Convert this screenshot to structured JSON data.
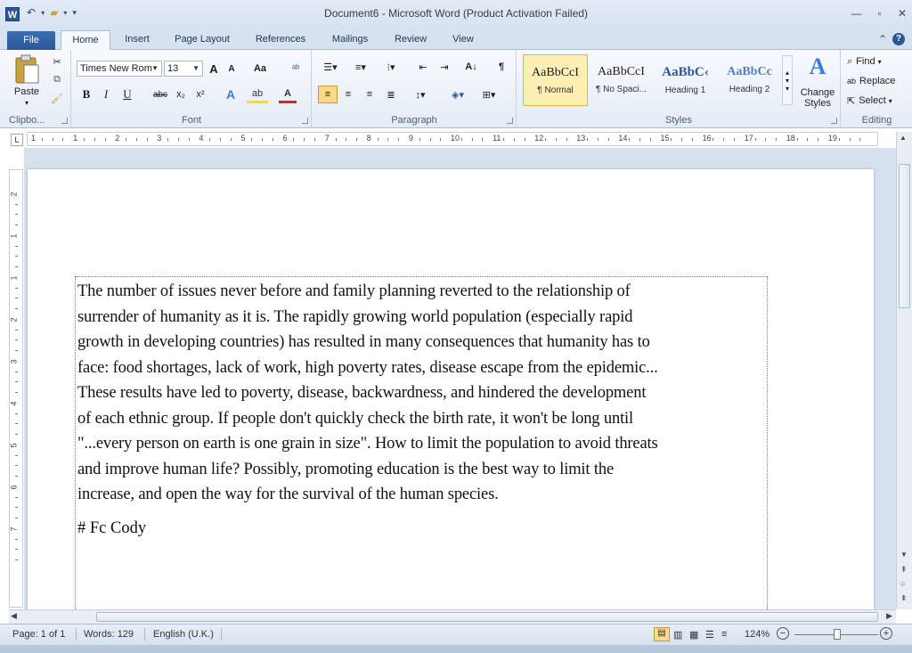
{
  "window": {
    "title": "Document6 - Microsoft Word (Product Activation Failed)",
    "app_icon": "W"
  },
  "tabs": [
    "File",
    "Home",
    "Insert",
    "Page Layout",
    "References",
    "Mailings",
    "Review",
    "View"
  ],
  "ribbon": {
    "clipboard": {
      "paste_label": "Paste",
      "group_label": "Clipbo..."
    },
    "font": {
      "name": "Times New Rom",
      "size": "13",
      "group_label": "Font",
      "grow": "A",
      "shrink": "A",
      "case": "Aa",
      "bold": "B",
      "italic": "I",
      "underline": "U",
      "strike": "abc",
      "sub": "x₂",
      "sup": "x²"
    },
    "paragraph": {
      "group_label": "Paragraph"
    },
    "styles": {
      "group_label": "Styles",
      "items": [
        {
          "sample": "AaBbCcI",
          "name": "¶ Normal"
        },
        {
          "sample": "AaBbCcI",
          "name": "¶ No Spaci..."
        },
        {
          "sample": "AaBbC‹",
          "name": "Heading 1"
        },
        {
          "sample": "AaBbCc",
          "name": "Heading 2"
        }
      ],
      "change_styles": "Change Styles"
    },
    "editing": {
      "group_label": "Editing",
      "find": "Find",
      "replace": "Replace",
      "select": "Select"
    }
  },
  "ruler": {
    "numbers": [
      "1",
      "1",
      "2",
      "3",
      "4",
      "5",
      "6",
      "7",
      "8",
      "9",
      "10",
      "11",
      "12",
      "13",
      "14",
      "15",
      "16",
      "17",
      "18",
      "19"
    ]
  },
  "vruler": {
    "numbers": [
      "2",
      "1",
      "1",
      "2",
      "3",
      "4",
      "5",
      "6",
      "7"
    ]
  },
  "document": {
    "lines": [
      "The number of issues never before and family planning reverted to the relationship of",
      "surrender of humanity as it is. The rapidly growing world population (especially rapid",
      "growth in developing countries) has resulted in many consequences that humanity has to",
      "face: food shortages, lack of work, high poverty rates, disease escape from the epidemic...",
      "These results have led to poverty, disease, backwardness, and hindered the development",
      "of each ethnic group. If people don't quickly check the birth rate, it won't be long until",
      "\"...every person on earth is one grain in size\". How to limit the population to avoid threats",
      "and improve human life? Possibly, promoting education is the best way to limit the",
      "increase, and open the way for the survival of the human species."
    ],
    "signature": "# Fc Cody"
  },
  "status": {
    "page": "Page: 1 of 1",
    "words": "Words: 129",
    "language": "English (U.K.)",
    "zoom": "124%"
  }
}
